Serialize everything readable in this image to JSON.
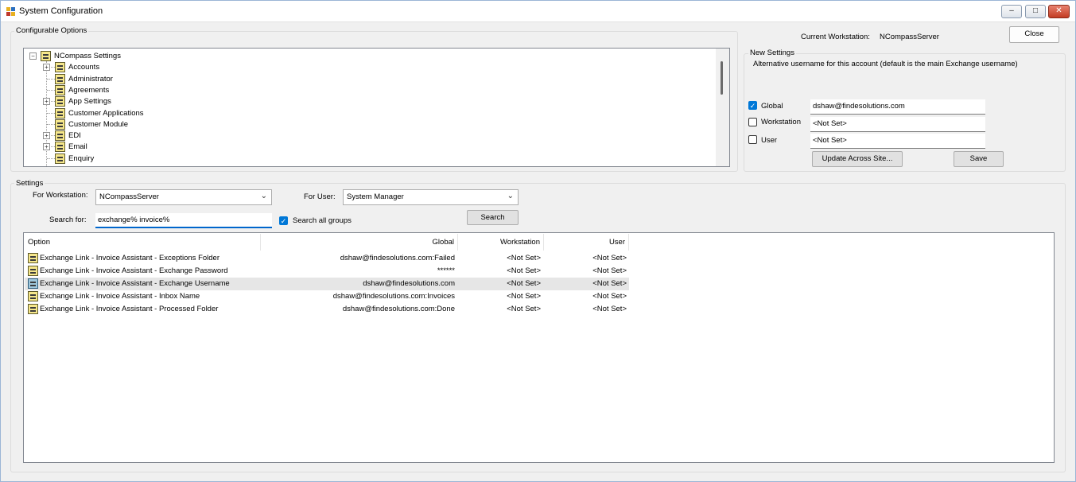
{
  "window": {
    "title": "System Configuration",
    "controls": {
      "minimize": "–",
      "maximize": "□",
      "close": "✕"
    }
  },
  "configurable_options": {
    "label": "Configurable Options",
    "tree": {
      "root": "NCompass Settings",
      "items": [
        {
          "label": "Accounts",
          "expandable": true
        },
        {
          "label": "Administrator",
          "expandable": false
        },
        {
          "label": "Agreements",
          "expandable": false
        },
        {
          "label": "App Settings",
          "expandable": true
        },
        {
          "label": "Customer Applications",
          "expandable": false
        },
        {
          "label": "Customer Module",
          "expandable": false
        },
        {
          "label": "EDI",
          "expandable": true
        },
        {
          "label": "Email",
          "expandable": true
        },
        {
          "label": "Enquiry",
          "expandable": false
        }
      ]
    }
  },
  "header": {
    "current_workstation_label": "Current Workstation:",
    "current_workstation_value": "NCompassServer",
    "close_label": "Close"
  },
  "new_settings": {
    "label": "New Settings",
    "description": "Alternative username for this account (default is the main Exchange username)",
    "global": {
      "label": "Global",
      "checked": true,
      "value": "dshaw@findesolutions.com"
    },
    "workstation": {
      "label": "Workstation",
      "checked": false,
      "value": "<Not Set>"
    },
    "user": {
      "label": "User",
      "checked": false,
      "value": "<Not Set>"
    },
    "update_label": "Update Across Site...",
    "save_label": "Save"
  },
  "settings": {
    "label": "Settings",
    "for_workstation_label": "For Workstation:",
    "for_workstation_value": "NCompassServer",
    "for_user_label": "For User:",
    "for_user_value": "System Manager",
    "search_for_label": "Search for:",
    "search_value": "exchange% invoice%",
    "search_all_groups_label": "Search all groups",
    "search_all_groups_checked": true,
    "search_button": "Search",
    "columns": [
      "Option",
      "Global",
      "Workstation",
      "User"
    ],
    "rows": [
      {
        "option": "Exchange Link - Invoice Assistant - Exceptions Folder",
        "global": "dshaw@findesolutions.com:Failed",
        "workstation": "<Not Set>",
        "user": "<Not Set>"
      },
      {
        "option": "Exchange Link - Invoice Assistant - Exchange Password",
        "global": "******",
        "workstation": "<Not Set>",
        "user": "<Not Set>"
      },
      {
        "option": "Exchange Link - Invoice Assistant - Exchange Username",
        "global": "dshaw@findesolutions.com",
        "workstation": "<Not Set>",
        "user": "<Not Set>",
        "selected": true
      },
      {
        "option": "Exchange Link - Invoice Assistant - Inbox Name",
        "global": "dshaw@findesolutions.com:Invoices",
        "workstation": "<Not Set>",
        "user": "<Not Set>"
      },
      {
        "option": "Exchange Link - Invoice Assistant - Processed Folder",
        "global": "dshaw@findesolutions.com:Done",
        "workstation": "<Not Set>",
        "user": "<Not Set>"
      }
    ]
  }
}
